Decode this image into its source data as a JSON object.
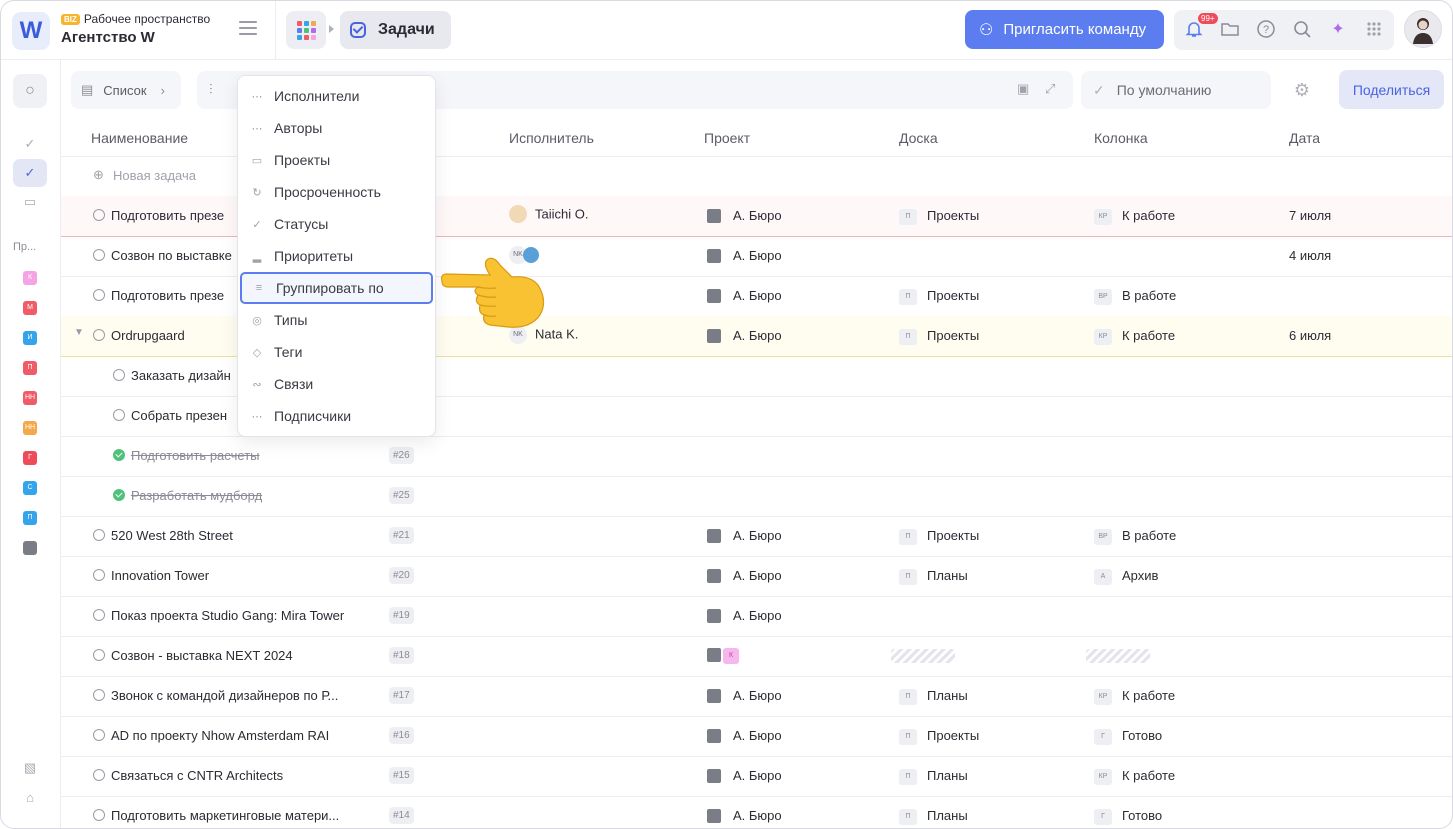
{
  "workspace": {
    "logo": "W",
    "badge": "BIZ",
    "subtitle": "Рабочее пространство",
    "name": "Агентство W"
  },
  "header": {
    "tab_label": "Задачи",
    "invite_label": "Пригласить команду",
    "notifications_badge": "99+"
  },
  "sidebar": {
    "section_label": "Пр...",
    "projects": [
      {
        "letter": "К",
        "color": "#f6a3e6"
      },
      {
        "letter": "М",
        "color": "#ef5b66"
      },
      {
        "letter": "И",
        "color": "#35a4ea"
      },
      {
        "letter": "П",
        "color": "#ef5b66"
      },
      {
        "letter": "НН",
        "color": "#ef5b66"
      },
      {
        "letter": "НН",
        "color": "#f5a84a"
      },
      {
        "letter": "Г",
        "color": "#ef4c5b"
      },
      {
        "letter": "С",
        "color": "#35a4ea"
      },
      {
        "letter": "П",
        "color": "#35a4ea"
      },
      {
        "letter": "",
        "color": "#7a7c86"
      }
    ]
  },
  "toolbar": {
    "view_label": "Список",
    "sort_label": "По умолчанию",
    "share_label": "Поделиться"
  },
  "columns": {
    "name": "Наименование",
    "assignee": "Исполнитель",
    "project": "Проект",
    "board": "Доска",
    "column": "Колонка",
    "date": "Дата"
  },
  "new_task_label": "Новая задача",
  "menu_items": [
    {
      "label": "Исполнители",
      "icon": "⋯"
    },
    {
      "label": "Авторы",
      "icon": "⋯"
    },
    {
      "label": "Проекты",
      "icon": "▭"
    },
    {
      "label": "Просроченность",
      "icon": "↻"
    },
    {
      "label": "Статусы",
      "icon": "✓"
    },
    {
      "label": "Приоритеты",
      "icon": "▂"
    },
    {
      "label": "Группировать по",
      "icon": "≡"
    },
    {
      "label": "Типы",
      "icon": "◎"
    },
    {
      "label": "Теги",
      "icon": "◇"
    },
    {
      "label": "Связи",
      "icon": "∾"
    },
    {
      "label": "Подписчики",
      "icon": "⋯"
    }
  ],
  "rows": [
    {
      "name": "Подготовить презе",
      "num": "",
      "assignee": "Taiichi O.",
      "project": "А. Бюро",
      "board_tag": "П",
      "board": "Проекты",
      "col_tag": "КР",
      "column": "К работе",
      "date": "7 июля"
    },
    {
      "name": "Созвон по выставке",
      "num": "",
      "assignee_nk": "NK",
      "assignee": "",
      "project": "А. Бюро",
      "board_tag": "",
      "board": "",
      "col_tag": "",
      "column": "",
      "date": "4 июля"
    },
    {
      "name": "Подготовить презе",
      "num": "",
      "assignee": "",
      "project": "А. Бюро",
      "board_tag": "П",
      "board": "Проекты",
      "col_tag": "ВР",
      "column": "В работе",
      "date": ""
    },
    {
      "name": "Ordrupgaard",
      "num": "",
      "assignee_nk": "NK",
      "assignee": "Nata K.",
      "project": "А. Бюро",
      "board_tag": "П",
      "board": "Проекты",
      "col_tag": "КР",
      "column": "К работе",
      "date": "6 июля"
    },
    {
      "name": "Заказать дизайн",
      "num": "",
      "assignee": "",
      "project": "",
      "board": "",
      "column": "",
      "date": ""
    },
    {
      "name": "Собрать презен",
      "num": "",
      "assignee": "",
      "project": "",
      "board": "",
      "column": "",
      "date": ""
    },
    {
      "name": "Подготовить расчеты",
      "num": "#26",
      "assignee": "",
      "project": "",
      "board": "",
      "column": "",
      "date": ""
    },
    {
      "name": "Разработать мудборд",
      "num": "#25",
      "assignee": "",
      "project": "",
      "board": "",
      "column": "",
      "date": ""
    },
    {
      "name": "520 West 28th Street",
      "num": "#21",
      "assignee": "",
      "project": "А. Бюро",
      "board_tag": "П",
      "board": "Проекты",
      "col_tag": "ВР",
      "column": "В работе",
      "date": ""
    },
    {
      "name": "Innovation Tower",
      "num": "#20",
      "assignee": "",
      "project": "А. Бюро",
      "board_tag": "П",
      "board": "Планы",
      "col_tag": "А",
      "column": "Архив",
      "date": ""
    },
    {
      "name": "Показ проекта Studio Gang: Mira Tower",
      "num": "#19",
      "assignee": "",
      "project": "А. Бюро",
      "board": "",
      "column": "",
      "date": ""
    },
    {
      "name": "Созвон - выставка NEXT 2024",
      "num": "#18",
      "assignee": "",
      "project": "",
      "project_tag": "К",
      "board": "",
      "column": "",
      "date": ""
    },
    {
      "name": "Звонок с командой дизайнеров по Р...",
      "num": "#17",
      "assignee": "",
      "project": "А. Бюро",
      "board_tag": "П",
      "board": "Планы",
      "col_tag": "КР",
      "column": "К работе",
      "date": ""
    },
    {
      "name": "AD по проекту Nhow Amsterdam RAI",
      "num": "#16",
      "assignee": "",
      "project": "А. Бюро",
      "board_tag": "П",
      "board": "Проекты",
      "col_tag": "Г",
      "column": "Готово",
      "date": ""
    },
    {
      "name": "Связаться с CNTR Architects",
      "num": "#15",
      "assignee": "",
      "project": "А. Бюро",
      "board_tag": "П",
      "board": "Планы",
      "col_tag": "КР",
      "column": "К работе",
      "date": ""
    },
    {
      "name": "Подготовить маркетинговые матери...",
      "num": "#14",
      "assignee": "",
      "project": "А. Бюро",
      "board_tag": "П",
      "board": "Планы",
      "col_tag": "Г",
      "column": "Готово",
      "date": ""
    }
  ]
}
